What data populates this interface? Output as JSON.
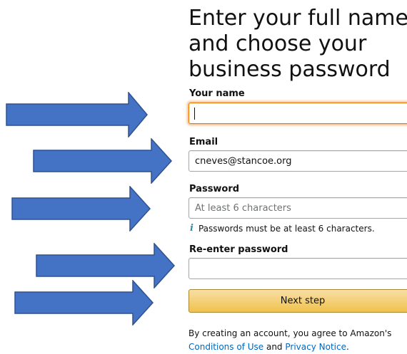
{
  "heading": "Enter your full name\nand choose your\nbusiness password",
  "form": {
    "name_label": "Your name",
    "name_value": "",
    "email_label": "Email",
    "email_value": "cneves@stancoe.org",
    "password_label": "Password",
    "password_placeholder": "At least 6 characters",
    "password_hint": "Passwords must be at least 6 characters.",
    "reenter_label": "Re-enter password",
    "reenter_value": "",
    "next_button": "Next step"
  },
  "legal": {
    "prefix": "By creating an account, you agree to Amazon's",
    "conditions_link": "Conditions of Use",
    "and": "and",
    "privacy_link": "Privacy Notice",
    "suffix": "."
  },
  "colors": {
    "arrow_fill": "#4472c4",
    "arrow_stroke": "#2f528f",
    "focus_border": "#e77600",
    "link": "#0066c0",
    "button_top": "#f7dfa5",
    "button_bottom": "#f0c14b"
  },
  "icons": {
    "info": "i",
    "annotation_arrows": "right-arrow"
  }
}
